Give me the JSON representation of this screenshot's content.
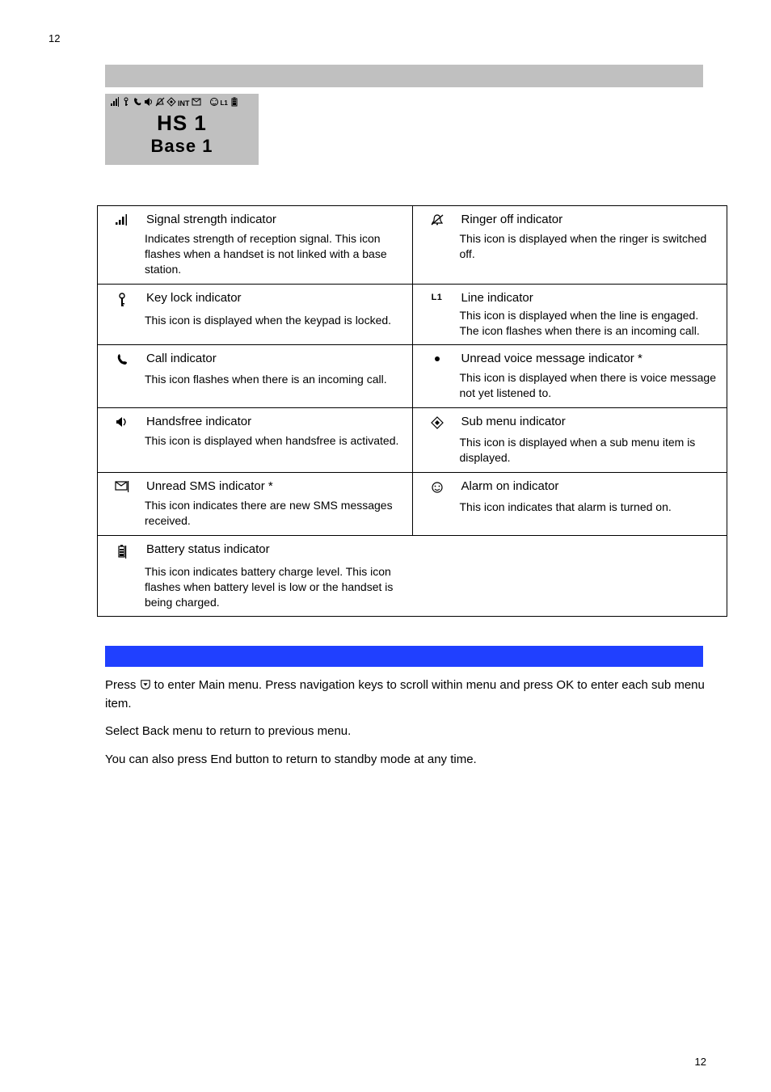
{
  "page_top": "12",
  "lcd": {
    "hs": "HS 1",
    "base": "Base 1",
    "int_label": "INT",
    "l1_label": "L1"
  },
  "table": {
    "r1c1": {
      "title": "Signal strength indicator",
      "desc": "Indicates strength of reception signal. This icon flashes when a handset is not linked with a base station."
    },
    "r1c2": {
      "title": "Ringer off indicator",
      "desc": "This icon is displayed when the ringer is switched off."
    },
    "r2c1": {
      "title": "Key lock indicator",
      "desc": "This icon is displayed when the keypad is locked."
    },
    "r2c2": {
      "title": "Line indicator",
      "desc": "This icon is displayed when the line is engaged. The icon flashes when there is an incoming call."
    },
    "r3c1": {
      "title": "Call indicator",
      "desc": "This icon flashes when there is an incoming call."
    },
    "r3c2": {
      "title": "Unread voice message indicator *",
      "desc": "This icon is displayed when there is voice message not yet listened to."
    },
    "r4c1": {
      "title": "Handsfree indicator",
      "desc": "This icon is displayed when handsfree is activated."
    },
    "r4c2": {
      "title": "Sub menu indicator",
      "desc": "This icon is displayed when a sub menu item is displayed."
    },
    "r5c1": {
      "title": "Unread SMS indicator *",
      "desc": "This icon indicates there are new SMS messages received."
    },
    "r5c2": {
      "title": "Alarm on indicator",
      "desc": "This icon indicates that alarm is turned on."
    },
    "r6c1": {
      "title": "Battery status indicator",
      "desc": "This icon indicates battery charge level. This icon flashes when battery level is low or the handset is being charged."
    }
  },
  "menu": {
    "p1_a": "Press ",
    "p1_b": " to enter Main menu. Press navigation keys to scroll within menu and press OK to enter each sub menu item.",
    "p2": "Select Back menu to return to previous menu.",
    "p3": "You can also press End button to return to standby mode at any time."
  },
  "page_bottom": "12"
}
